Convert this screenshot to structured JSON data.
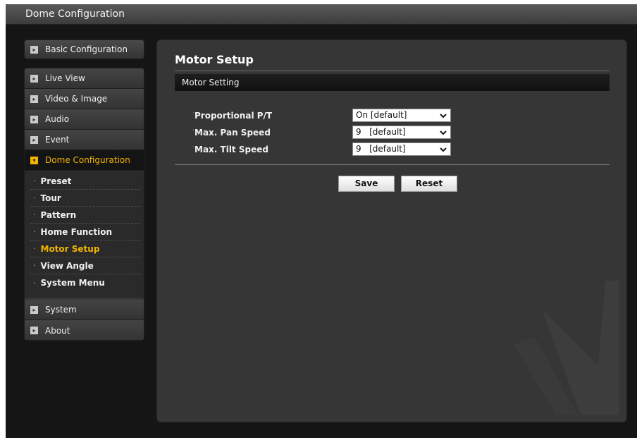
{
  "window": {
    "title": "Dome Configuration"
  },
  "sidebar": {
    "basic": "Basic Configuration",
    "live_view": "Live View",
    "video_image": "Video & Image",
    "audio": "Audio",
    "event": "Event",
    "dome_config": "Dome Configuration",
    "sub_items": [
      "Preset",
      "Tour",
      "Pattern",
      "Home Function",
      "Motor Setup",
      "View Angle",
      "System Menu"
    ],
    "active_sub": "Motor Setup",
    "system": "System",
    "about": "About"
  },
  "main": {
    "heading": "Motor Setup",
    "section": "Motor Setting",
    "fields": [
      {
        "label": "Proportional P/T",
        "value": "On [default]"
      },
      {
        "label": "Max. Pan Speed",
        "value": "9   [default]"
      },
      {
        "label": "Max. Tilt Speed",
        "value": "9   [default]"
      }
    ],
    "save_label": "Save",
    "reset_label": "Reset"
  },
  "colors": {
    "accent": "#f0b400",
    "background": "#151515",
    "panel": "#363636"
  },
  "icons": {
    "nav_bullet": "square-arrow-icon",
    "dropdown": "chevron-down-icon"
  }
}
